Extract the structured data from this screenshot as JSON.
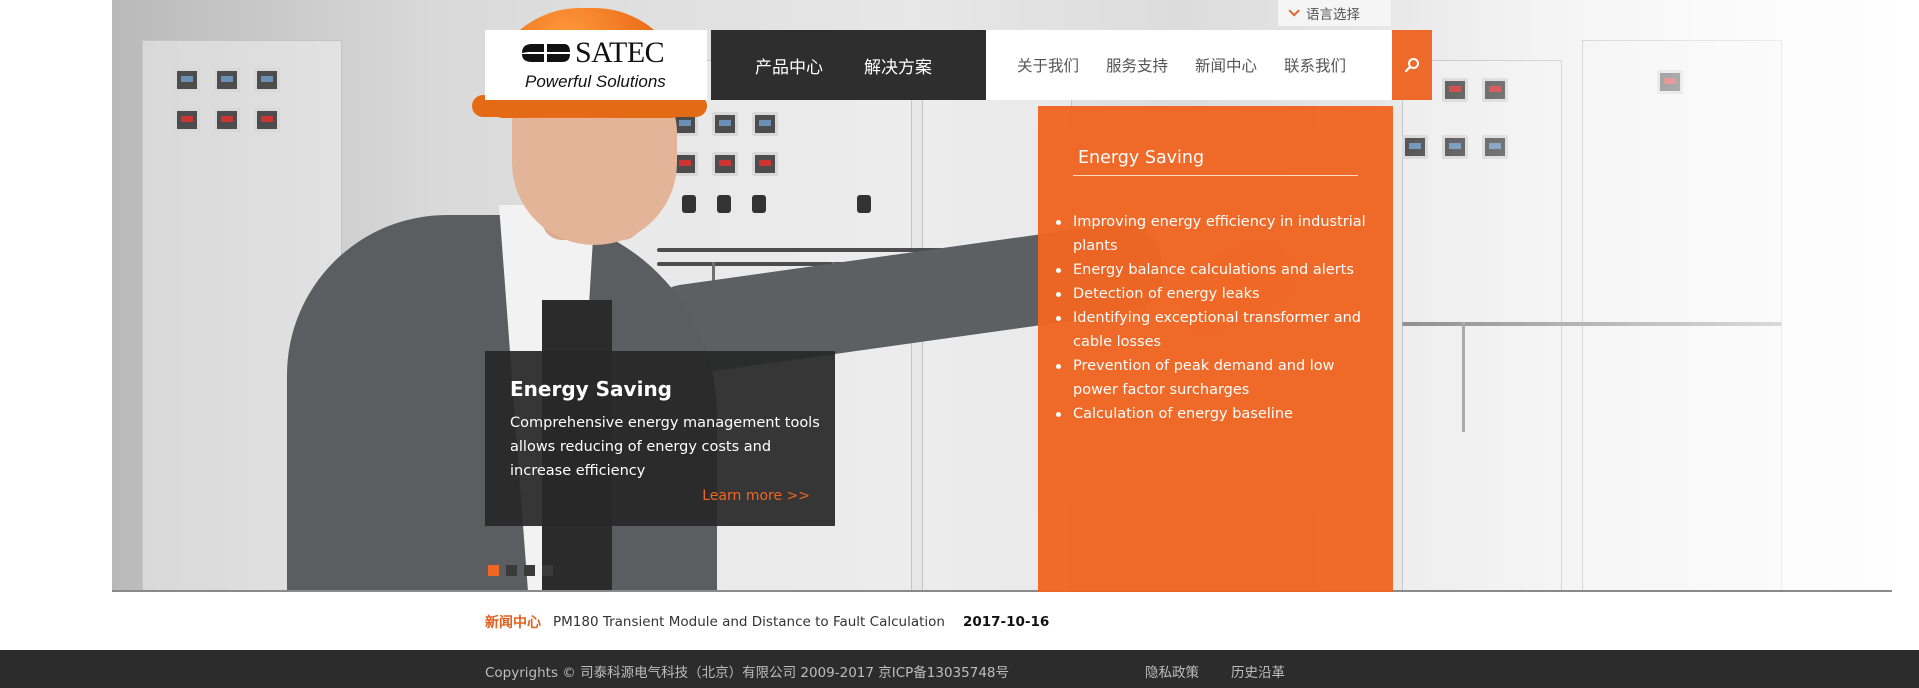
{
  "header": {
    "logo": {
      "brand": "SATEC",
      "tagline": "Powerful Solutions"
    },
    "language_selector": "语言选择",
    "nav_primary": [
      {
        "label": "产品中心"
      },
      {
        "label": "解决方案"
      }
    ],
    "nav_secondary": [
      {
        "label": "关于我们"
      },
      {
        "label": "服务支持"
      },
      {
        "label": "新闻中心"
      },
      {
        "label": "联系我们"
      }
    ],
    "search_icon": "search-icon"
  },
  "hero": {
    "panel": {
      "title": "Energy Saving",
      "items": [
        "Improving energy efficiency in industrial plants",
        "Energy balance calculations and alerts",
        "Detection of energy leaks",
        "Identifying exceptional transformer and cable losses",
        "Prevention of peak demand and low power factor surcharges",
        "Calculation of energy baseline"
      ]
    },
    "caption": {
      "title": "Energy Saving",
      "text": "Comprehensive energy management tools allows reducing of energy costs and increase efficiency",
      "link": "Learn more >>"
    },
    "slider": {
      "count": 4,
      "active_index": 0
    }
  },
  "news": {
    "label": "新闻中心",
    "title": "PM180 Transient Module and Distance to Fault Calculation",
    "date": "2017-10-16"
  },
  "footer": {
    "copyright": "Copyrights © 司泰科源电气科技（北京）有限公司 2009-2017 京ICP备13035748号",
    "links": [
      "隐私政策",
      "历史沿革"
    ]
  },
  "colors": {
    "accent": "#f06623",
    "dark": "#2e2e2e",
    "footer": "#2c2c2c"
  }
}
